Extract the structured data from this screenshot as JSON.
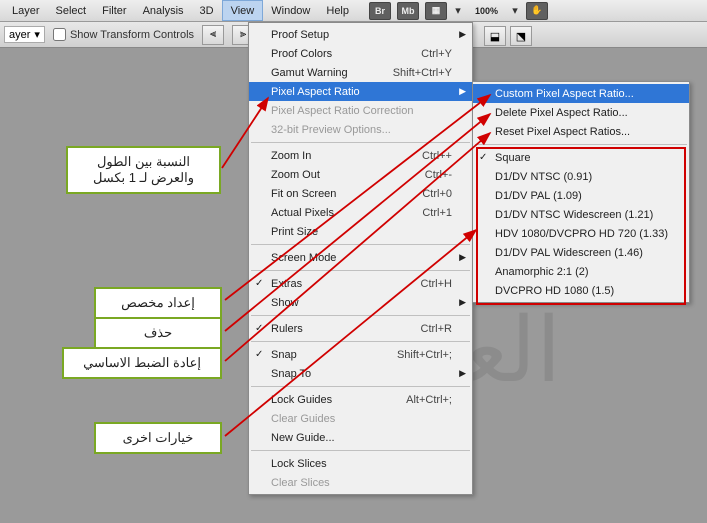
{
  "menubar": {
    "items": [
      "Layer",
      "Select",
      "Filter",
      "Analysis",
      "3D",
      "View",
      "Window",
      "Help"
    ],
    "active_idx": 5,
    "icons": [
      "Br",
      "Mb"
    ],
    "zoom": "100%"
  },
  "toolbar": {
    "sel_label": "ayer",
    "show_transform": "Show Transform Controls"
  },
  "dropdown": [
    {
      "label": "Proof Setup",
      "sub": true
    },
    {
      "label": "Proof Colors",
      "shortcut": "Ctrl+Y"
    },
    {
      "label": "Gamut Warning",
      "shortcut": "Shift+Ctrl+Y"
    },
    {
      "label": "Pixel Aspect Ratio",
      "sub": true,
      "highlight": true
    },
    {
      "label": "Pixel Aspect Ratio Correction",
      "disabled": true
    },
    {
      "label": "32-bit Preview Options...",
      "disabled": true
    },
    {
      "sep": true
    },
    {
      "label": "Zoom In",
      "shortcut": "Ctrl++"
    },
    {
      "label": "Zoom Out",
      "shortcut": "Ctrl+-"
    },
    {
      "label": "Fit on Screen",
      "shortcut": "Ctrl+0"
    },
    {
      "label": "Actual Pixels",
      "shortcut": "Ctrl+1"
    },
    {
      "label": "Print Size"
    },
    {
      "sep": true
    },
    {
      "label": "Screen Mode",
      "sub": true
    },
    {
      "sep": true
    },
    {
      "label": "Extras",
      "shortcut": "Ctrl+H",
      "checked": true
    },
    {
      "label": "Show",
      "sub": true
    },
    {
      "sep": true
    },
    {
      "label": "Rulers",
      "shortcut": "Ctrl+R",
      "checked": true
    },
    {
      "sep": true
    },
    {
      "label": "Snap",
      "shortcut": "Shift+Ctrl+;",
      "checked": true
    },
    {
      "label": "Snap To",
      "sub": true
    },
    {
      "sep": true
    },
    {
      "label": "Lock Guides",
      "shortcut": "Alt+Ctrl+;"
    },
    {
      "label": "Clear Guides",
      "disabled": true
    },
    {
      "label": "New Guide..."
    },
    {
      "sep": true
    },
    {
      "label": "Lock Slices"
    },
    {
      "label": "Clear Slices",
      "disabled": true
    }
  ],
  "submenu": [
    {
      "label": "Custom Pixel Aspect Ratio...",
      "highlight": true
    },
    {
      "label": "Delete Pixel Aspect Ratio..."
    },
    {
      "label": "Reset Pixel Aspect Ratios..."
    },
    {
      "sep": true
    },
    {
      "label": "Square",
      "checked": true
    },
    {
      "label": "D1/DV NTSC (0.91)"
    },
    {
      "label": "D1/DV PAL (1.09)"
    },
    {
      "label": "D1/DV NTSC Widescreen (1.21)"
    },
    {
      "label": "HDV 1080/DVCPRO HD 720 (1.33)"
    },
    {
      "label": "D1/DV PAL Widescreen (1.46)"
    },
    {
      "label": "Anamorphic 2:1 (2)"
    },
    {
      "label": "DVCPRO HD 1080 (1.5)"
    }
  ],
  "annotations": {
    "top": "النسبة بين الطول والعرض لـ 1 بكسل",
    "custom": "إعداد مخصص",
    "delete": "حذف",
    "reset": "إعادة الضبط الاساسي",
    "other": "خيارات اخرى"
  },
  "watermark": "العـ"
}
